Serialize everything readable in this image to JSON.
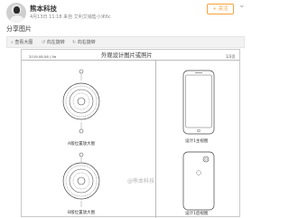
{
  "post": {
    "author": "熊本科技",
    "meta": "4月13日 11:18 来自 艾利艾销售小米6c",
    "follow_label": "+ 关注",
    "more_icon": "chevron-down-icon",
    "text": "分享图片"
  },
  "toolbar": {
    "items": [
      {
        "icon": "search-icon",
        "label": "查看大图"
      },
      {
        "icon": "rotate-left-icon",
        "label": "向左旋转"
      },
      {
        "icon": "rotate-right-icon",
        "label": "向右旋转"
      }
    ]
  },
  "document": {
    "date": "2019.08.06 | 9a",
    "title": "外观设计图片或照片",
    "page": "1/3页",
    "captions": {
      "ring_a": "A版位置放大图",
      "ring_b": "B版位置放大图",
      "phone_front": "设计1主视图",
      "phone_back": "设计1后视图"
    },
    "watermark": "@熊本科技"
  }
}
